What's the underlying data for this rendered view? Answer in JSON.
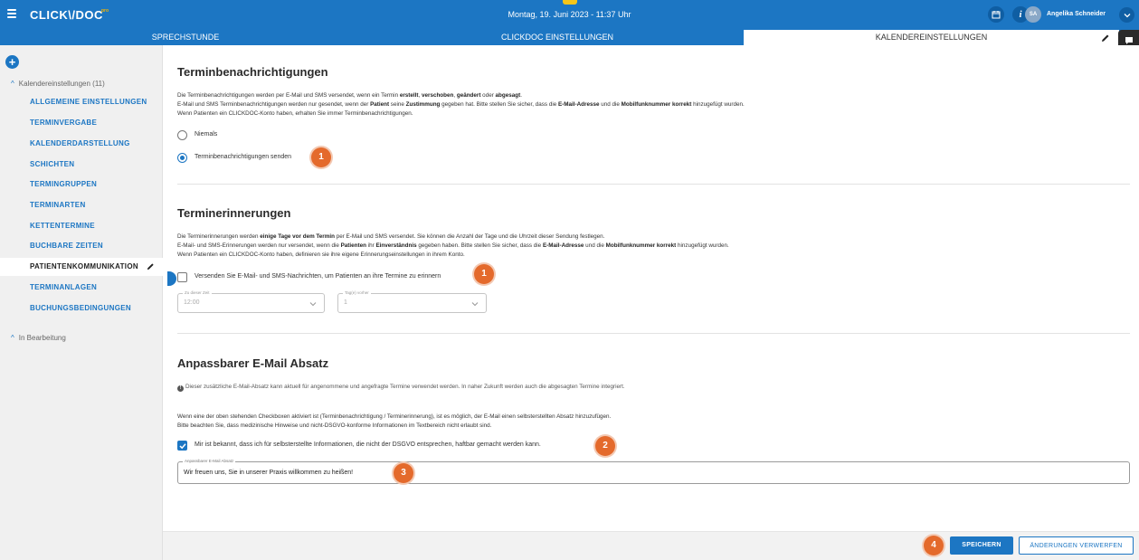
{
  "topbar": {
    "logo": "CLICK\\/DOC",
    "logo_pro": "pro",
    "datetime": "Montag, 19. Juni 2023 - 11:37 Uhr",
    "avatar_initials": "SA",
    "user_name": "Angelika Schneider"
  },
  "tabs": [
    {
      "label": "SPRECHSTUNDE"
    },
    {
      "label": "CLICKDOC EINSTELLUNGEN"
    },
    {
      "label": "KALENDEREINSTELLUNGEN"
    }
  ],
  "sidebar": {
    "add_label": "+",
    "group1": "Kalendereinstellungen (11)",
    "items": [
      {
        "label": "ALLGEMEINE EINSTELLUNGEN"
      },
      {
        "label": "TERMINVERGABE"
      },
      {
        "label": "KALENDERDARSTELLUNG"
      },
      {
        "label": "SCHICHTEN"
      },
      {
        "label": "TERMINGRUPPEN"
      },
      {
        "label": "TERMINARTEN"
      },
      {
        "label": "KETTENTERMINE"
      },
      {
        "label": "BUCHBARE ZEITEN"
      },
      {
        "label": "PATIENTENKOMMUNIKATION"
      },
      {
        "label": "TERMINANLAGEN"
      },
      {
        "label": "BUCHUNGSBEDINGUNGEN"
      }
    ],
    "group2": "In Bearbeitung"
  },
  "section1": {
    "title": "Terminbenachrichtigungen",
    "line1_a": "Die Terminbenachrichtigungen werden per E-Mail und SMS versendet, wenn ein Termin ",
    "line1_b": "erstellt",
    "line1_c": ", ",
    "line1_d": "verschoben",
    "line1_e": ", ",
    "line1_f": "geändert",
    "line1_g": " oder ",
    "line1_h": "abgesagt",
    "line1_i": ".",
    "line2_a": "E-Mail und SMS Terminbenachrichtigungen werden nur gesendet, wenn der ",
    "line2_b": "Patient",
    "line2_c": " seine ",
    "line2_d": "Zustimmung",
    "line2_e": " gegeben hat. Bitte stellen Sie sicher, dass die ",
    "line2_f": "E-Mail-Adresse",
    "line2_g": " und die ",
    "line2_h": "Mobilfunknummer korrekt",
    "line2_i": " hinzugefügt wurden.",
    "line3": "Wenn Patienten ein CLICKDOC-Konto haben, erhalten Sie immer Terminbenachrichtigungen.",
    "option_never": "Niemals",
    "option_send": "Terminbenachrichtigungen senden",
    "selected": "Terminbenachrichtigungen senden",
    "badge": "1"
  },
  "section2": {
    "title": "Terminerinnerungen",
    "line1_a": "Die Terminerinnerungen werden ",
    "line1_b": "einige Tage vor dem Termin",
    "line1_c": " per E-Mail und SMS versendet. Sie können die Anzahl der Tage und die Uhrzeit dieser Sendung festlegen.",
    "line2_a": "E-Mail- und SMS-Erinnerungen werden nur versendet, wenn die ",
    "line2_b": "Patienten",
    "line2_c": " ihr ",
    "line2_d": "Einverständnis",
    "line2_e": " gegeben haben. Bitte stellen Sie sicher, dass die ",
    "line2_f": "E-Mail-Adresse",
    "line2_g": " und die ",
    "line2_h": "Mobilfunknummer korrekt",
    "line2_i": " hinzugefügt wurden.",
    "line3": "Wenn Patienten ein CLICKDOC-Konto haben, definieren sie ihre eigene Erinnerungseinstellungen in ihrem Konto.",
    "checkbox_label": "Versenden Sie E-Mail- und SMS-Nachrichten, um Patienten an ihre Termine zu erinnern",
    "checkbox_checked": false,
    "badge": "1",
    "time_label": "Zu dieser Zeit",
    "time_value": "12:00",
    "days_label": "Tag(e) vorher",
    "days_value": "1"
  },
  "section3": {
    "title": "Anpassbarer E-Mail Absatz",
    "info": "Dieser zusätzliche E-Mail-Absatz kann aktuell für angenommene und angefragte Termine verwendet werden. In naher Zukunft werden auch die abgesagten Termine integriert.",
    "info_icon": "!",
    "line1": "Wenn eine der oben stehenden Checkboxen aktiviert ist (Terminbenachrichtigung / Terminerinnerung), ist es möglich, der E-Mail einen selbsterstellten Absatz hinzuzufügen.",
    "line2": "Bitte beachten Sie, dass medizinische Hinweise und nicht-DSGVO-konforme Informationen im Textbereich nicht erlaubt sind.",
    "checkbox_label": "Mir ist bekannt, dass ich für selbsterstellte Informationen, die nicht der DSGVO entsprechen, haftbar gemacht werden kann.",
    "checkbox_checked": true,
    "badge_check": "2",
    "field_label": "Anpassbarer E-Mail Absatz",
    "field_value": "Wir freuen uns, Sie in unserer Praxis willkommen zu heißen!",
    "badge_field": "3"
  },
  "footer": {
    "badge": "4",
    "save": "SPEICHERN",
    "discard": "ÄNDERUNGEN VERWERFEN"
  },
  "colors": {
    "primary": "#1c76c3",
    "badge": "#e46a2c"
  }
}
